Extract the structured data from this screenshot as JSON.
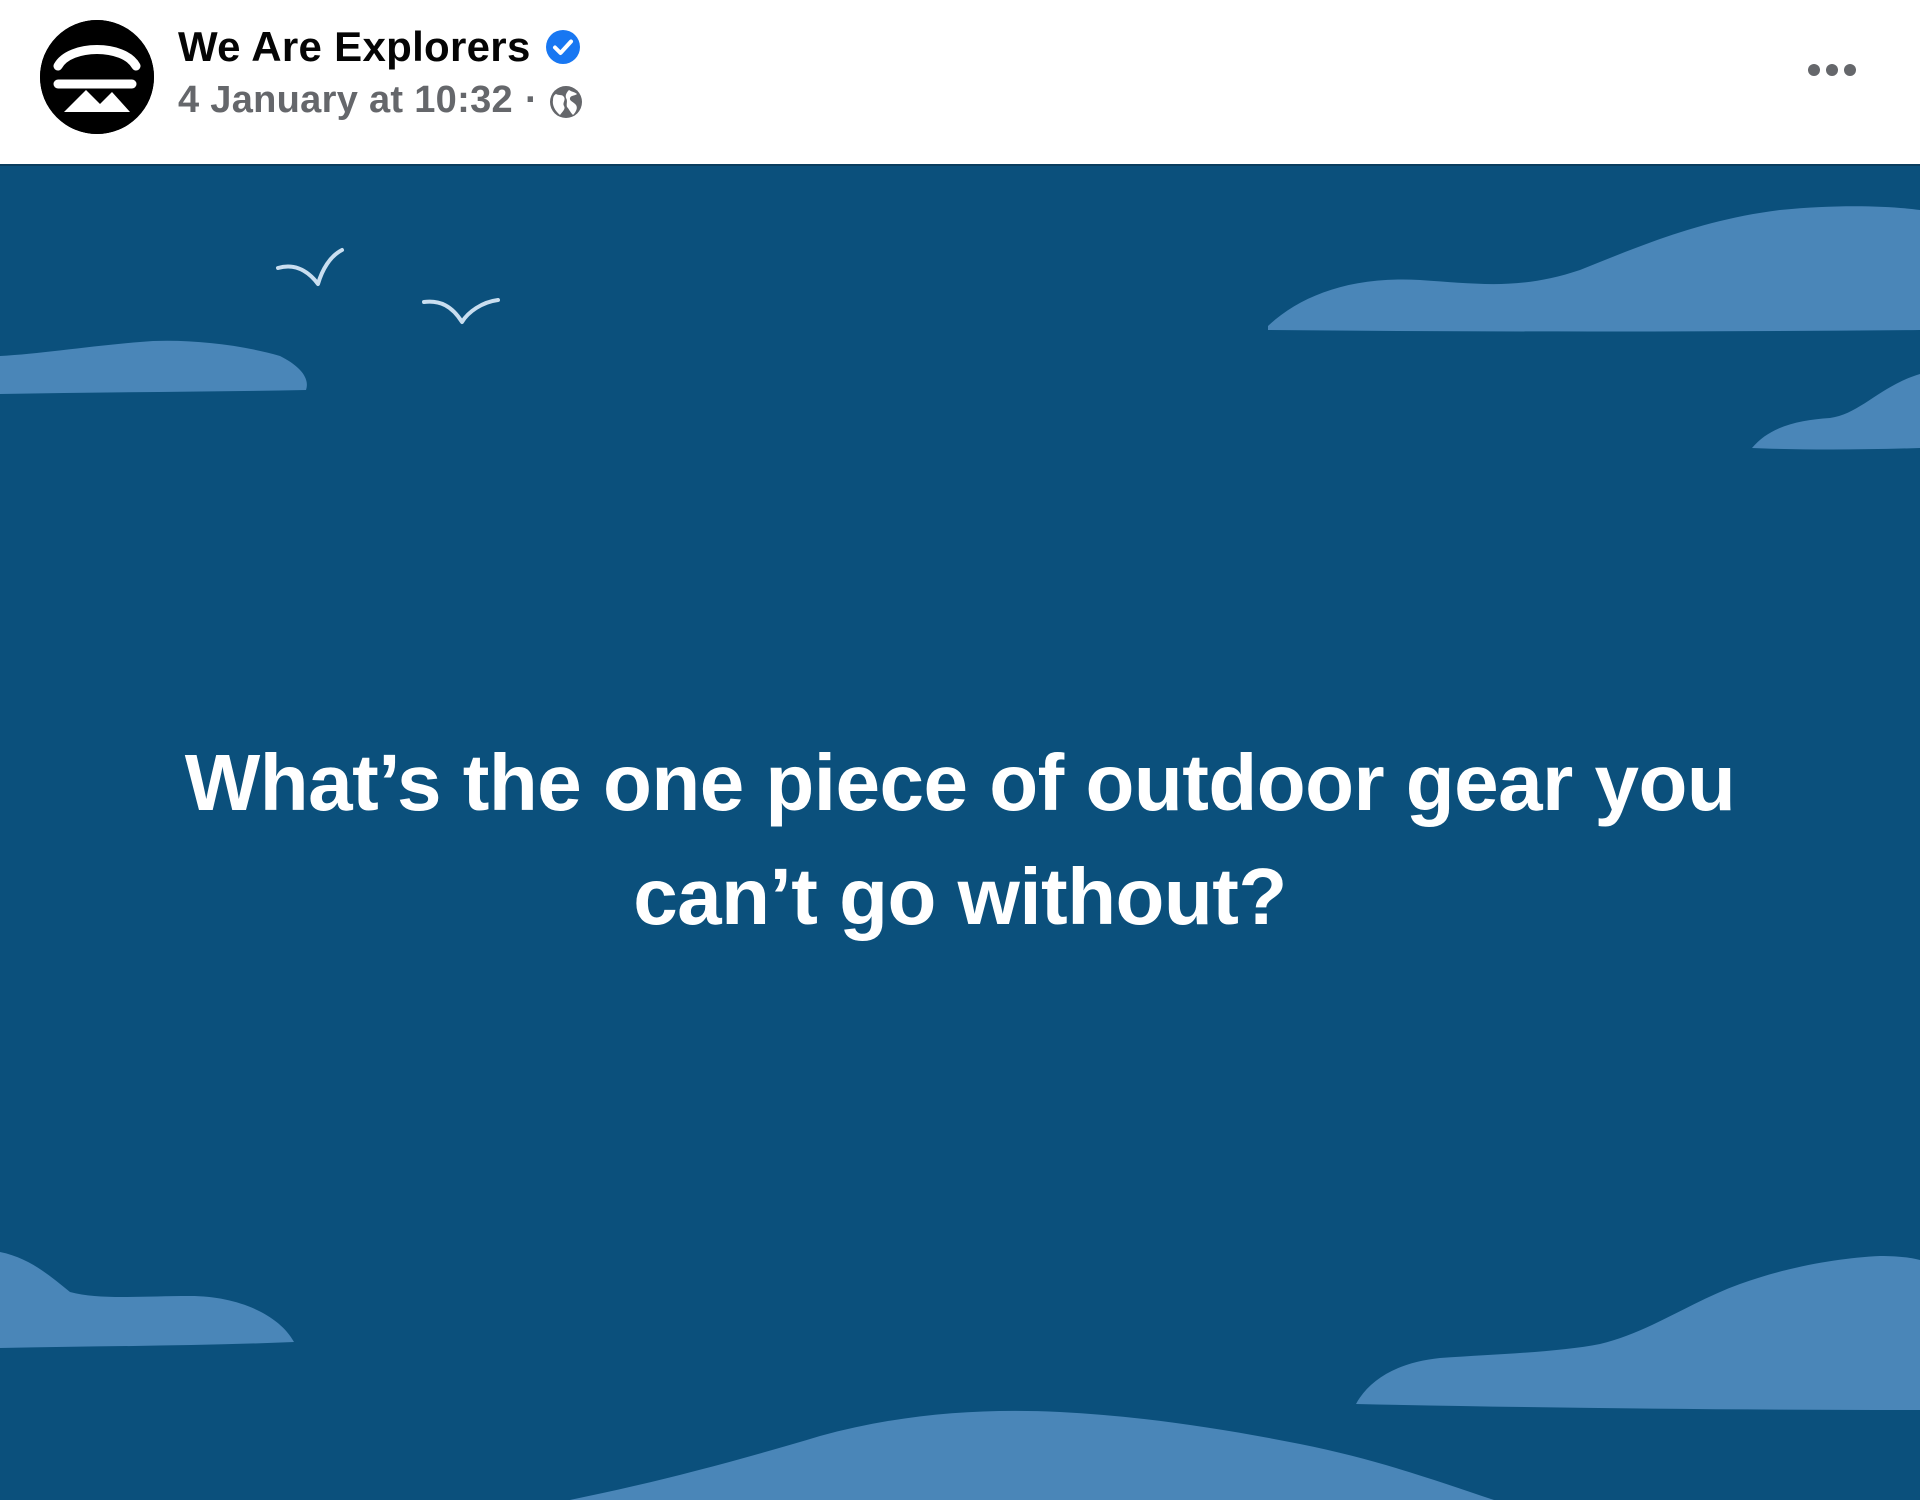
{
  "post": {
    "author": {
      "name": "We Are Explorers",
      "verified": true,
      "avatar_icon": "we-are-explorers-logo-icon"
    },
    "timestamp": "4 January at 10:32",
    "separator": "·",
    "audience_icon": "globe-icon",
    "more_icon": "more-horizontal-icon",
    "background": {
      "color": "#0b507c",
      "cloud_color": "#4a86b8",
      "bird_color": "#c9def0"
    },
    "text": "What’s the one piece of outdoor gear you can’t go without?"
  },
  "colors": {
    "author_name": "#050505",
    "meta_text": "#65676b",
    "verified_badge": "#1877f2",
    "post_text": "#ffffff"
  }
}
